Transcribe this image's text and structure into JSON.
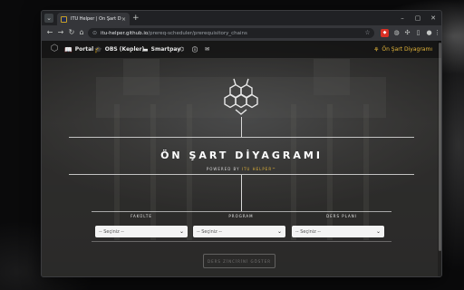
{
  "browser": {
    "tab_title": "ITU Helper | Ön Şart Diyagramı",
    "tab_close": "×",
    "new_tab": "+",
    "tab_search": "⌄",
    "url_host": "itu-helper.github.io",
    "url_path": "/prereq-scheduler/prerequisitory_chains",
    "win_min": "–",
    "win_max": "▢",
    "win_close": "✕"
  },
  "nav": {
    "items": [
      {
        "label": "Portal",
        "icon": "📖"
      },
      {
        "label": "OBS (Kepler)",
        "icon": "🎓"
      },
      {
        "label": "Smartpay",
        "icon": "▬"
      }
    ],
    "right_label": "Ön Şart Diyagramı"
  },
  "hero": {
    "title": "ÖN ŞART DİYAGRAMI",
    "powered_prefix": "POWERED BY",
    "powered_brand": "ITU HELPER™"
  },
  "selectors": {
    "headers": [
      "FAKÜLTE",
      "PROGRAM",
      "DERS PLANI"
    ],
    "values": [
      "-- Seçiniz --",
      "-- Seçiniz --",
      "-- Seçiniz --"
    ]
  },
  "submit_label": "DERS ZİNCİRİNİ GÖSTER",
  "colors": {
    "accent": "#e3b53a",
    "chrome_dark": "#202124",
    "chrome_toolbar": "#35363a"
  }
}
